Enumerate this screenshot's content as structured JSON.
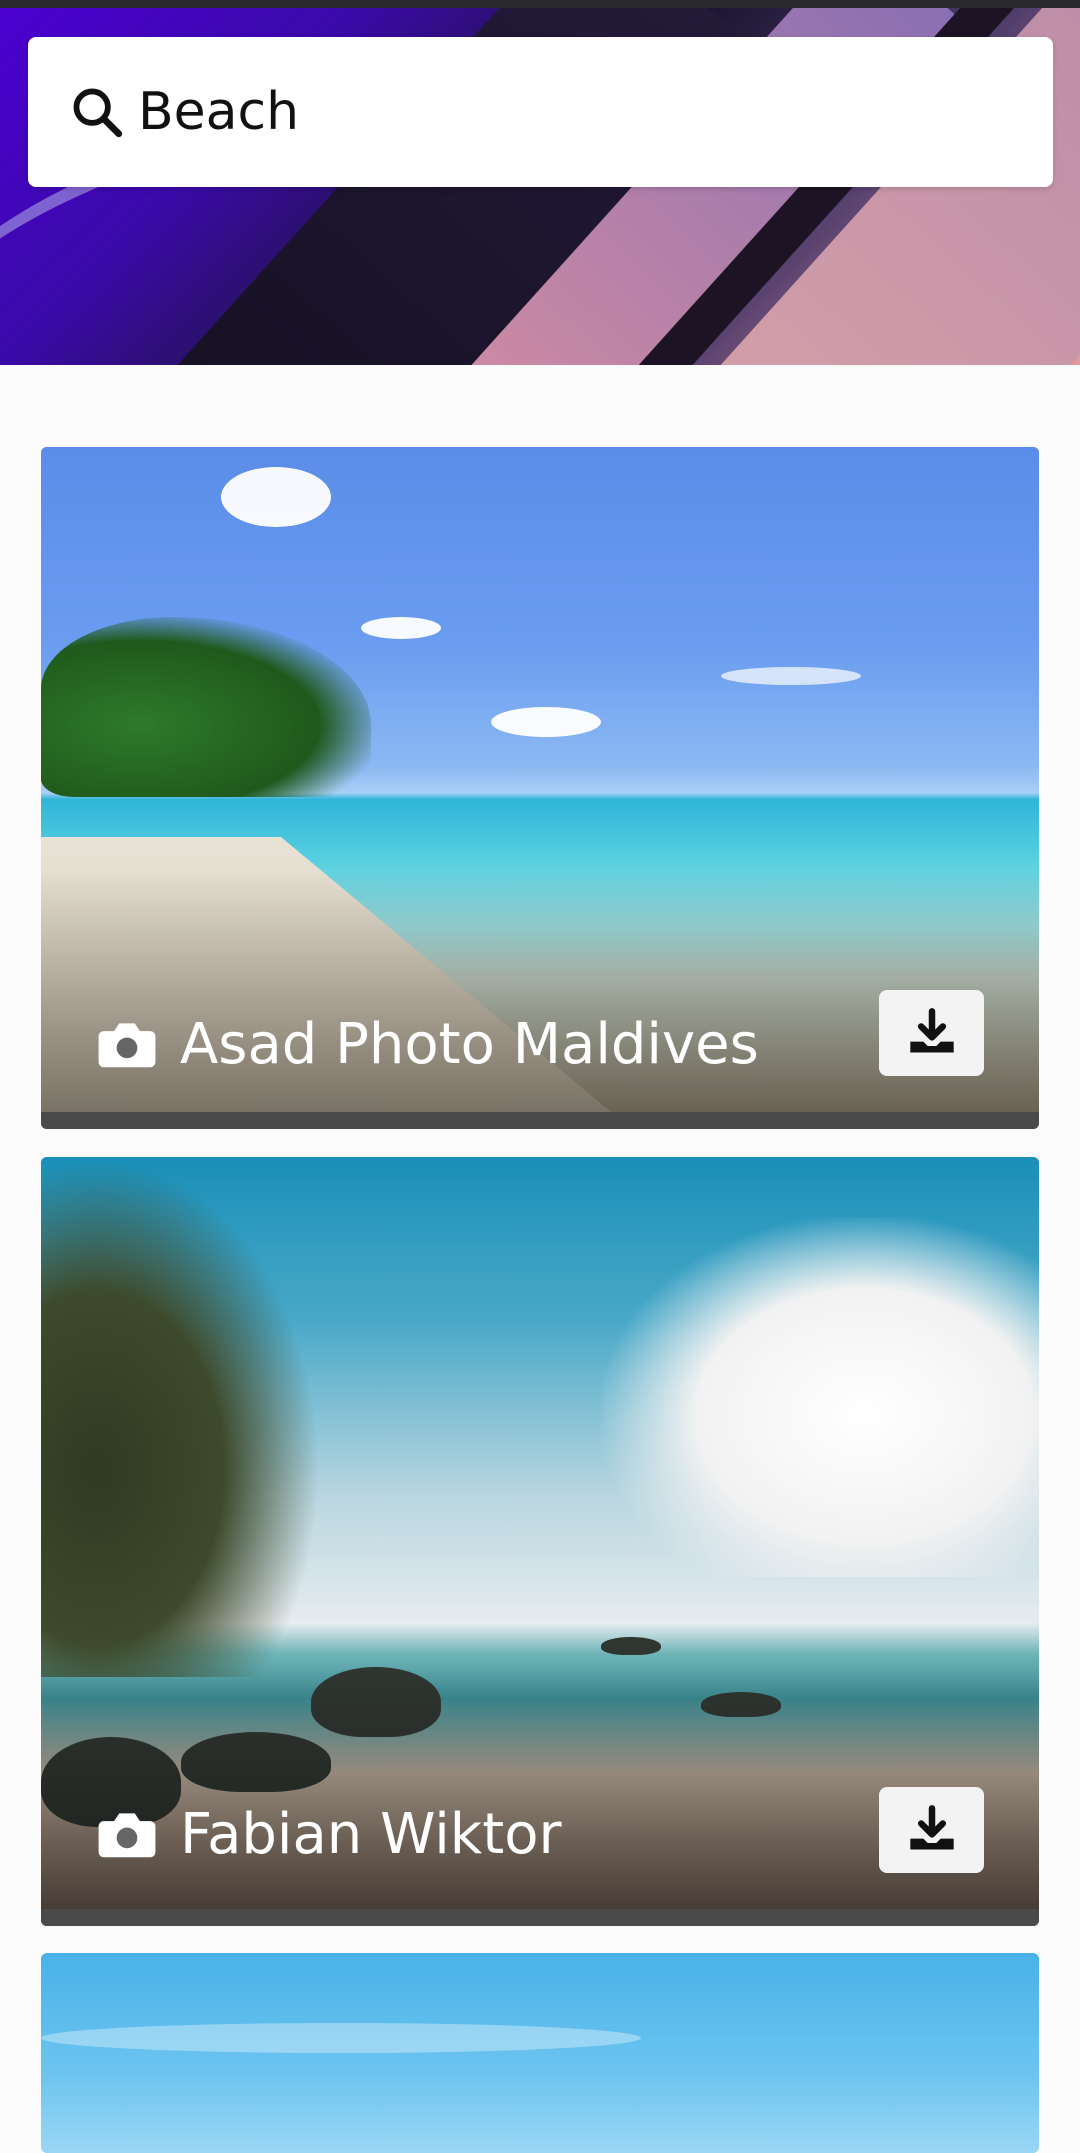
{
  "search": {
    "value": "Beach",
    "icon": "search-icon"
  },
  "results": [
    {
      "photographer": "Asad Photo Maldives",
      "photo_description": "tropical beach with leaning palm tree",
      "icon": "camera-icon",
      "action_icon": "download-icon"
    },
    {
      "photographer": "Fabian Wiktor",
      "photo_description": "rocky beach shore with palm trees and clouds",
      "icon": "camera-icon",
      "action_icon": "download-icon"
    },
    {
      "photo_description": "blue sky (partially visible)"
    }
  ],
  "colors": {
    "hero_accent": "#4b00d1",
    "card_bar": "#4a4a4a",
    "button_bg": "#f3f3f3"
  }
}
